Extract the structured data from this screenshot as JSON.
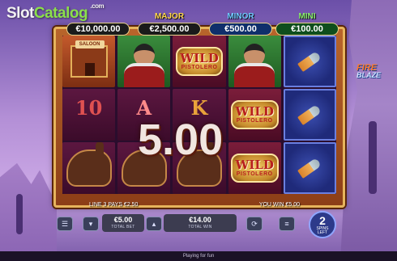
{
  "watermark": {
    "slot": "Slot",
    "catalog": "Catalog",
    "suffix": ".com"
  },
  "jackpots": {
    "grand": {
      "label": "",
      "value": "€10,000.00"
    },
    "major": {
      "label": "MAJOR",
      "value": "€2,500.00"
    },
    "minor": {
      "label": "MINOR",
      "value": "€500.00"
    },
    "mini": {
      "label": "MINI",
      "value": "€100.00"
    }
  },
  "reels": [
    [
      {
        "type": "saloon",
        "text": "SALOON"
      },
      {
        "type": "card",
        "text": "10"
      },
      {
        "type": "horse",
        "text": ""
      }
    ],
    [
      {
        "type": "man",
        "text": ""
      },
      {
        "type": "card",
        "text": "A"
      },
      {
        "type": "horse",
        "text": ""
      }
    ],
    [
      {
        "type": "wild",
        "text": "WILD",
        "sub": "PISTOLERO"
      },
      {
        "type": "card",
        "text": "K"
      },
      {
        "type": "horse",
        "text": ""
      }
    ],
    [
      {
        "type": "man",
        "text": ""
      },
      {
        "type": "wild",
        "text": "WILD",
        "sub": "PISTOLERO"
      },
      {
        "type": "wild",
        "text": "WILD",
        "sub": "PISTOLERO"
      }
    ],
    [
      {
        "type": "bullet",
        "text": ""
      },
      {
        "type": "bullet",
        "text": ""
      },
      {
        "type": "bullet",
        "text": ""
      }
    ]
  ],
  "win_amount": "5.00",
  "line_win": {
    "left": "LINE 3 PAYS €2.50",
    "right": "YOU WIN €5.00"
  },
  "logo": {
    "line1": "FIRE",
    "line2": "BLAZE"
  },
  "bet": {
    "value": "€5.00",
    "label": "TOTAL BET"
  },
  "total_win": {
    "value": "€14.00",
    "label": "TOTAL WIN"
  },
  "spins_left": {
    "count": "2",
    "label_a": "SPINS",
    "label_b": "LEFT"
  },
  "footer": "Playing for fun",
  "icons": [
    "menu-icon",
    "minus-icon",
    "plus-icon",
    "autoplay-icon",
    "speed-icon"
  ]
}
